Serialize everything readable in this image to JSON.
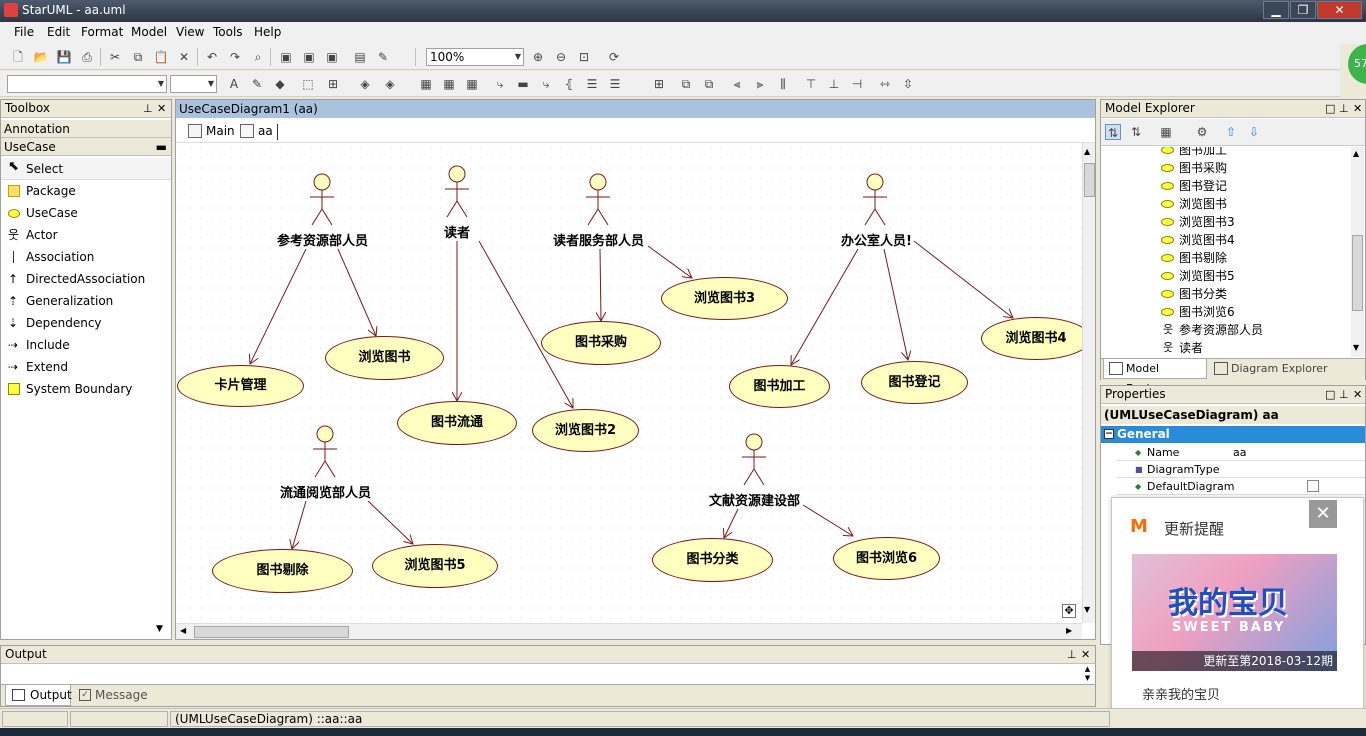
{
  "window": {
    "title": "StarUML - aa.uml",
    "min": "▁",
    "max": "❐",
    "close": "✕"
  },
  "menu": [
    "File",
    "Edit",
    "Format",
    "Model",
    "View",
    "Tools",
    "Help"
  ],
  "toolbar": {
    "zoom": "100%"
  },
  "toolbox": {
    "title": "Toolbox",
    "sections": {
      "annotation": "Annotation",
      "usecase": "UseCase"
    },
    "items": [
      {
        "label": "Select",
        "icon": "cursor-icon"
      },
      {
        "label": "Package",
        "icon": "package-icon"
      },
      {
        "label": "UseCase",
        "icon": "usecase-icon"
      },
      {
        "label": "Actor",
        "icon": "actor-icon"
      },
      {
        "label": "Association",
        "icon": "association-icon"
      },
      {
        "label": "DirectedAssociation",
        "icon": "directed-association-icon"
      },
      {
        "label": "Generalization",
        "icon": "generalization-icon"
      },
      {
        "label": "Dependency",
        "icon": "dependency-icon"
      },
      {
        "label": "Include",
        "icon": "include-icon"
      },
      {
        "label": "Extend",
        "icon": "extend-icon"
      },
      {
        "label": "System Boundary",
        "icon": "system-boundary-icon"
      }
    ]
  },
  "diagram": {
    "title": "UseCaseDiagram1 (aa)",
    "tabs": [
      "Main",
      "aa"
    ],
    "actors": [
      "参考资源部人员",
      "读者",
      "读者服务部人员",
      "办公室人员!",
      "流通阅览部人员",
      "文献资源建设部"
    ],
    "usecases": [
      "卡片管理",
      "浏览图书",
      "图书流通",
      "浏览图书2",
      "图书采购",
      "浏览图书3",
      "图书加工",
      "图书登记",
      "浏览图书4",
      "图书剔除",
      "浏览图书5",
      "图书分类",
      "图书浏览6"
    ]
  },
  "explorer": {
    "title": "Model Explorer",
    "items": [
      "图书加工",
      "图书采购",
      "图书登记",
      "浏览图书",
      "浏览图书3",
      "浏览图书4",
      "图书剔除",
      "浏览图书5",
      "图书分类",
      "图书浏览6",
      "参考资源部人员",
      "读者"
    ],
    "tabs": [
      "Model Explorer",
      "Diagram Explorer"
    ]
  },
  "properties": {
    "title": "Properties",
    "header": "(UMLUseCaseDiagram) aa",
    "group": "General",
    "rows": [
      {
        "name": "Name",
        "value": "aa"
      },
      {
        "name": "DiagramType",
        "value": ""
      },
      {
        "name": "DefaultDiagram",
        "value": ""
      }
    ]
  },
  "popup": {
    "title": "更新提醒",
    "banner": "更新至第2018-03-12期",
    "caption": "亲亲我的宝贝",
    "close": "✕",
    "art_text": "我的宝贝",
    "art_sub": "SWEET BABY"
  },
  "output": {
    "title": "Output",
    "tabs": [
      "Output",
      "Message"
    ]
  },
  "status": {
    "path": "(UMLUseCaseDiagram) ::aa::aa"
  },
  "badge": "57"
}
